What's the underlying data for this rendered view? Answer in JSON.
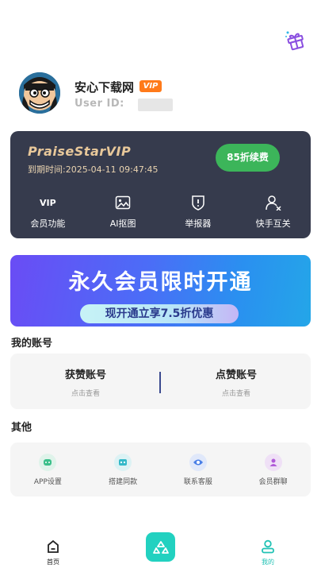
{
  "profile": {
    "username": "安心下载网",
    "vip_badge": "VIP",
    "uid_label": "User ID:"
  },
  "vip_card": {
    "title": "PraiseStarVIP",
    "expire": "到期时间:2025-04-11 09:47:45",
    "renew_label": "85折续费",
    "features": [
      {
        "label": "会员功能",
        "icon": "vip-icon"
      },
      {
        "label": "AI抠图",
        "icon": "image-icon"
      },
      {
        "label": "举报器",
        "icon": "alert-shield-icon"
      },
      {
        "label": "快手互关",
        "icon": "user-x-icon"
      }
    ],
    "vip_icon_text": "VIP"
  },
  "banner": {
    "title": "永久会员限时开通",
    "subtitle": "现开通立享7.5折优惠"
  },
  "my_accounts": {
    "section_title": "我的账号",
    "items": [
      {
        "title": "获赞账号",
        "sub": "点击查看"
      },
      {
        "title": "点赞账号",
        "sub": "点击查看"
      }
    ]
  },
  "other": {
    "section_title": "其他",
    "items": [
      {
        "label": "APP设置",
        "icon": "settings-face-icon",
        "color": "#3bbf8a",
        "bg": "#dff3ea"
      },
      {
        "label": "搭建同款",
        "icon": "build-face-icon",
        "color": "#35b9c9",
        "bg": "#dcf2f4"
      },
      {
        "label": "联系客服",
        "icon": "eye-icon",
        "color": "#4a7fe6",
        "bg": "#e0e8fa"
      },
      {
        "label": "会员群聊",
        "icon": "group-person-icon",
        "color": "#b05ad8",
        "bg": "#efe0f6"
      }
    ]
  },
  "tabbar": {
    "home_label": "首页",
    "mine_label": "我的",
    "active_color": "#22c2b5"
  }
}
